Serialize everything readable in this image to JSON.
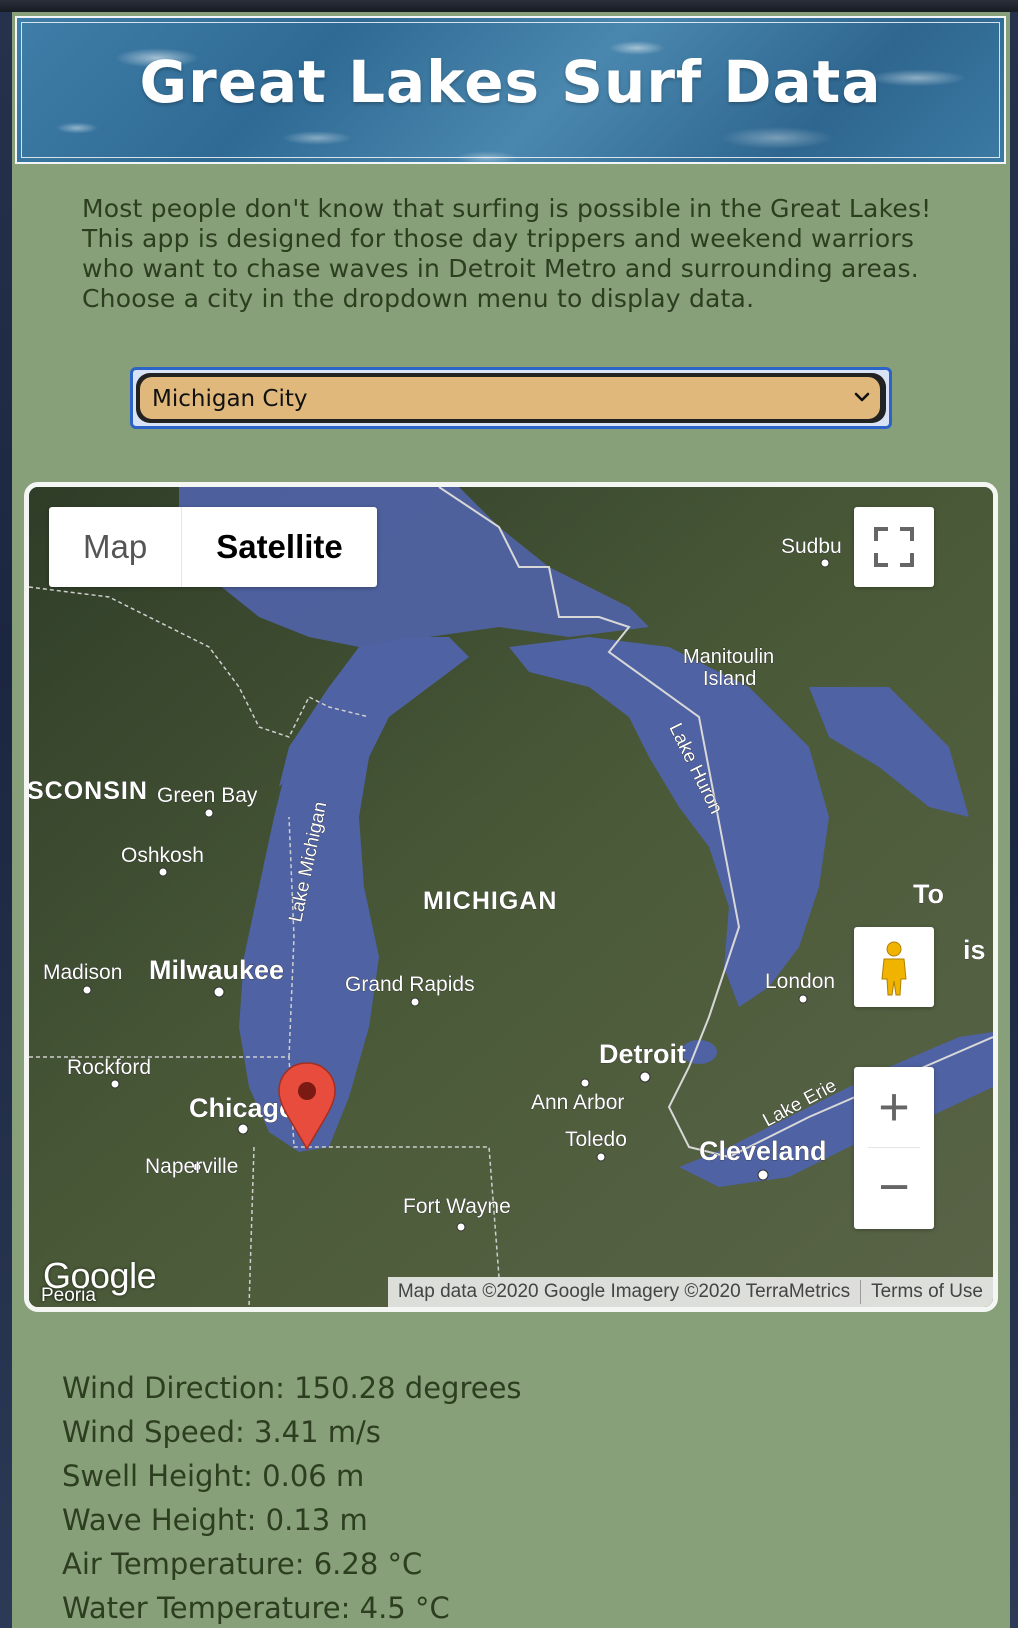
{
  "header": {
    "title": "Great Lakes Surf Data"
  },
  "intro": {
    "text": "Most people don't know that surfing is possible in the Great Lakes! This app is designed for those day trippers and weekend warriors who want to chase waves in Detroit Metro and surrounding areas. Choose a city in the dropdown menu to display data."
  },
  "city_select": {
    "selected": "Michigan City"
  },
  "map": {
    "type_map_label": "Map",
    "type_satellite_label": "Satellite",
    "active_type": "Satellite",
    "logo": "Google",
    "attribution": "Map data ©2020 Google Imagery ©2020 TerraMetrics",
    "terms": "Terms of Use",
    "zoom_in": "+",
    "zoom_out": "−",
    "places": {
      "wisconsin": "SCONSIN",
      "green_bay": "Green Bay",
      "oshkosh": "Oshkosh",
      "madison": "Madison",
      "milwaukee": "Milwaukee",
      "rockford": "Rockford",
      "chicago": "Chicago",
      "naperville": "Naperville",
      "peoria": "Peoria",
      "michigan": "MICHIGAN",
      "grand_rapids": "Grand Rapids",
      "lake_michigan": "Lake Michigan",
      "lake_huron": "Lake Huron",
      "manitoulin_1": "Manitoulin",
      "manitoulin_2": "Island",
      "sudbury": "Sudbu",
      "london": "London",
      "detroit": "Detroit",
      "ann_arbor": "Ann Arbor",
      "toledo": "Toledo",
      "cleveland": "Cleveland",
      "lake_erie": "Lake Erie",
      "fort_wayne": "Fort Wayne",
      "to": "To",
      "is": "is"
    },
    "icons": [
      "fullscreen-icon",
      "pegman-icon",
      "map-marker-icon"
    ],
    "colors": {
      "marker": "#e74c3c",
      "water": "#4f62a3"
    }
  },
  "surf_data": {
    "wind_direction": "Wind Direction: 150.28 degrees",
    "wind_speed": "Wind Speed: 3.41 m/s",
    "swell_height": "Swell Height: 0.06 m",
    "wave_height": "Wave Height: 0.13 m",
    "air_temperature": "Air Temperature: 6.28 °C",
    "water_temperature": "Water Temperature: 4.5 °C"
  },
  "colors": {
    "page_bg": "#87a079",
    "text": "#2c3e1f",
    "select_bg": "#e0b87c",
    "select_focus": "#2b63c7"
  }
}
